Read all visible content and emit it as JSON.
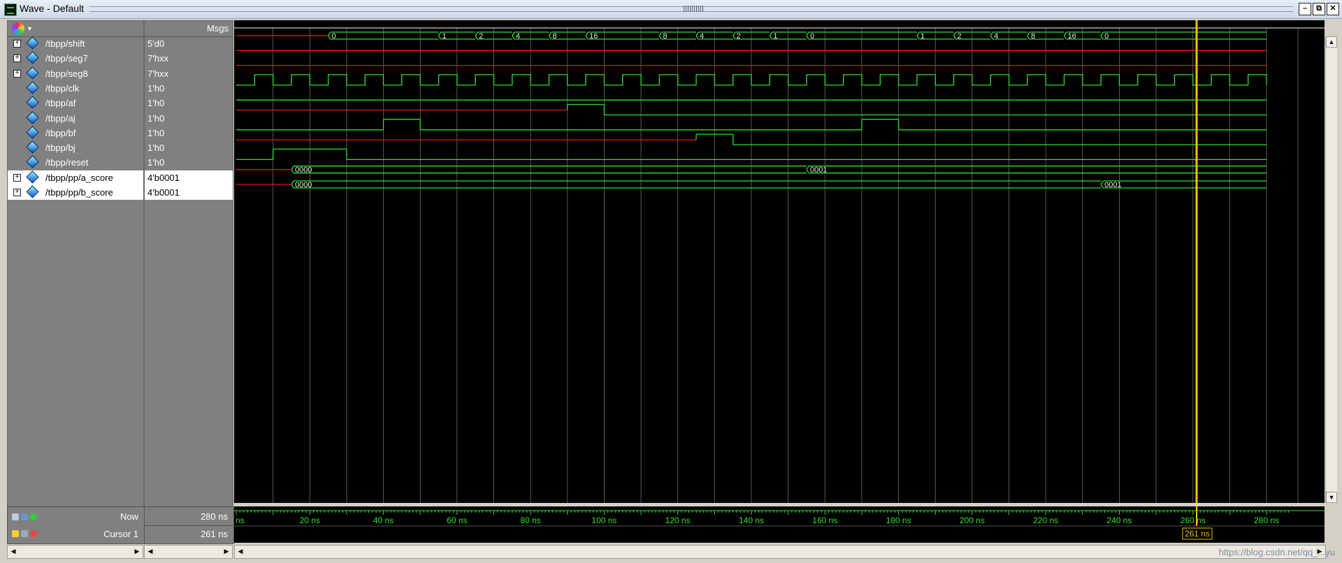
{
  "window": {
    "title": "Wave - Default"
  },
  "header": {
    "msgs_label": "Msgs"
  },
  "signals": [
    {
      "name": "/tbpp/shift",
      "value": "5'd0",
      "expandable": true,
      "bus": true
    },
    {
      "name": "/tbpp/seg7",
      "value": "7'hxx",
      "expandable": true,
      "bus": false
    },
    {
      "name": "/tbpp/seg8",
      "value": "7'hxx",
      "expandable": true,
      "bus": false
    },
    {
      "name": "/tbpp/clk",
      "value": "1'h0",
      "expandable": false
    },
    {
      "name": "/tbpp/af",
      "value": "1'h0",
      "expandable": false
    },
    {
      "name": "/tbpp/aj",
      "value": "1'h0",
      "expandable": false
    },
    {
      "name": "/tbpp/bf",
      "value": "1'h0",
      "expandable": false
    },
    {
      "name": "/tbpp/bj",
      "value": "1'h0",
      "expandable": false
    },
    {
      "name": "/tbpp/reset",
      "value": "1'h0",
      "expandable": false
    },
    {
      "name": "/tbpp/pp/a_score",
      "value": "4'b0001",
      "expandable": true,
      "selected": true
    },
    {
      "name": "/tbpp/pp/b_score",
      "value": "4'b0001",
      "expandable": true,
      "selected": true
    }
  ],
  "waveforms": {
    "time_max": 280,
    "shift": [
      [
        0,
        "x"
      ],
      [
        25,
        "0"
      ],
      [
        55,
        "1"
      ],
      [
        65,
        "2"
      ],
      [
        75,
        "4"
      ],
      [
        85,
        "8"
      ],
      [
        95,
        "16"
      ],
      [
        115,
        "8"
      ],
      [
        125,
        "4"
      ],
      [
        135,
        "2"
      ],
      [
        145,
        "1"
      ],
      [
        155,
        "0"
      ],
      [
        185,
        "1"
      ],
      [
        195,
        "2"
      ],
      [
        205,
        "4"
      ],
      [
        215,
        "8"
      ],
      [
        225,
        "16"
      ],
      [
        235,
        "0"
      ]
    ],
    "a_score": [
      [
        0,
        "x"
      ],
      [
        15,
        "0000"
      ],
      [
        155,
        "0001"
      ]
    ],
    "b_score": [
      [
        0,
        "x"
      ],
      [
        15,
        "0000"
      ],
      [
        235,
        "0001"
      ]
    ],
    "af": [
      [
        0,
        "0"
      ]
    ],
    "aj": [
      [
        0,
        "x"
      ],
      [
        90,
        "1"
      ],
      [
        100,
        "0"
      ]
    ],
    "bf": [
      [
        0,
        "0"
      ],
      [
        40,
        "1"
      ],
      [
        50,
        "0"
      ],
      [
        170,
        "1"
      ],
      [
        180,
        "0"
      ]
    ],
    "bj": [
      [
        0,
        "x"
      ],
      [
        125,
        "1"
      ],
      [
        135,
        "0"
      ]
    ],
    "reset": [
      [
        0,
        "0"
      ],
      [
        10,
        "1"
      ],
      [
        30,
        "0"
      ]
    ],
    "clk_period": 10
  },
  "status": {
    "now_label": "Now",
    "now_value": "280 ns",
    "cursor_label": "Cursor 1",
    "cursor_value": "261 ns",
    "cursor_time": 261,
    "cursor_marker": "261 ns"
  },
  "timeline": {
    "left_fragment": "ns",
    "ticks": [
      "20 ns",
      "40 ns",
      "60 ns",
      "80 ns",
      "100 ns",
      "120 ns",
      "140 ns",
      "160 ns",
      "180 ns",
      "200 ns",
      "220 ns",
      "240 ns",
      "260 ns",
      "280 ns"
    ]
  },
  "watermark": "https://blog.csdn.net/qq_...yu",
  "colors": {
    "wave_green": "#2ee02e",
    "wave_red": "#e01818",
    "cursor": "#f2c200",
    "grid": "#5a5a5a"
  }
}
